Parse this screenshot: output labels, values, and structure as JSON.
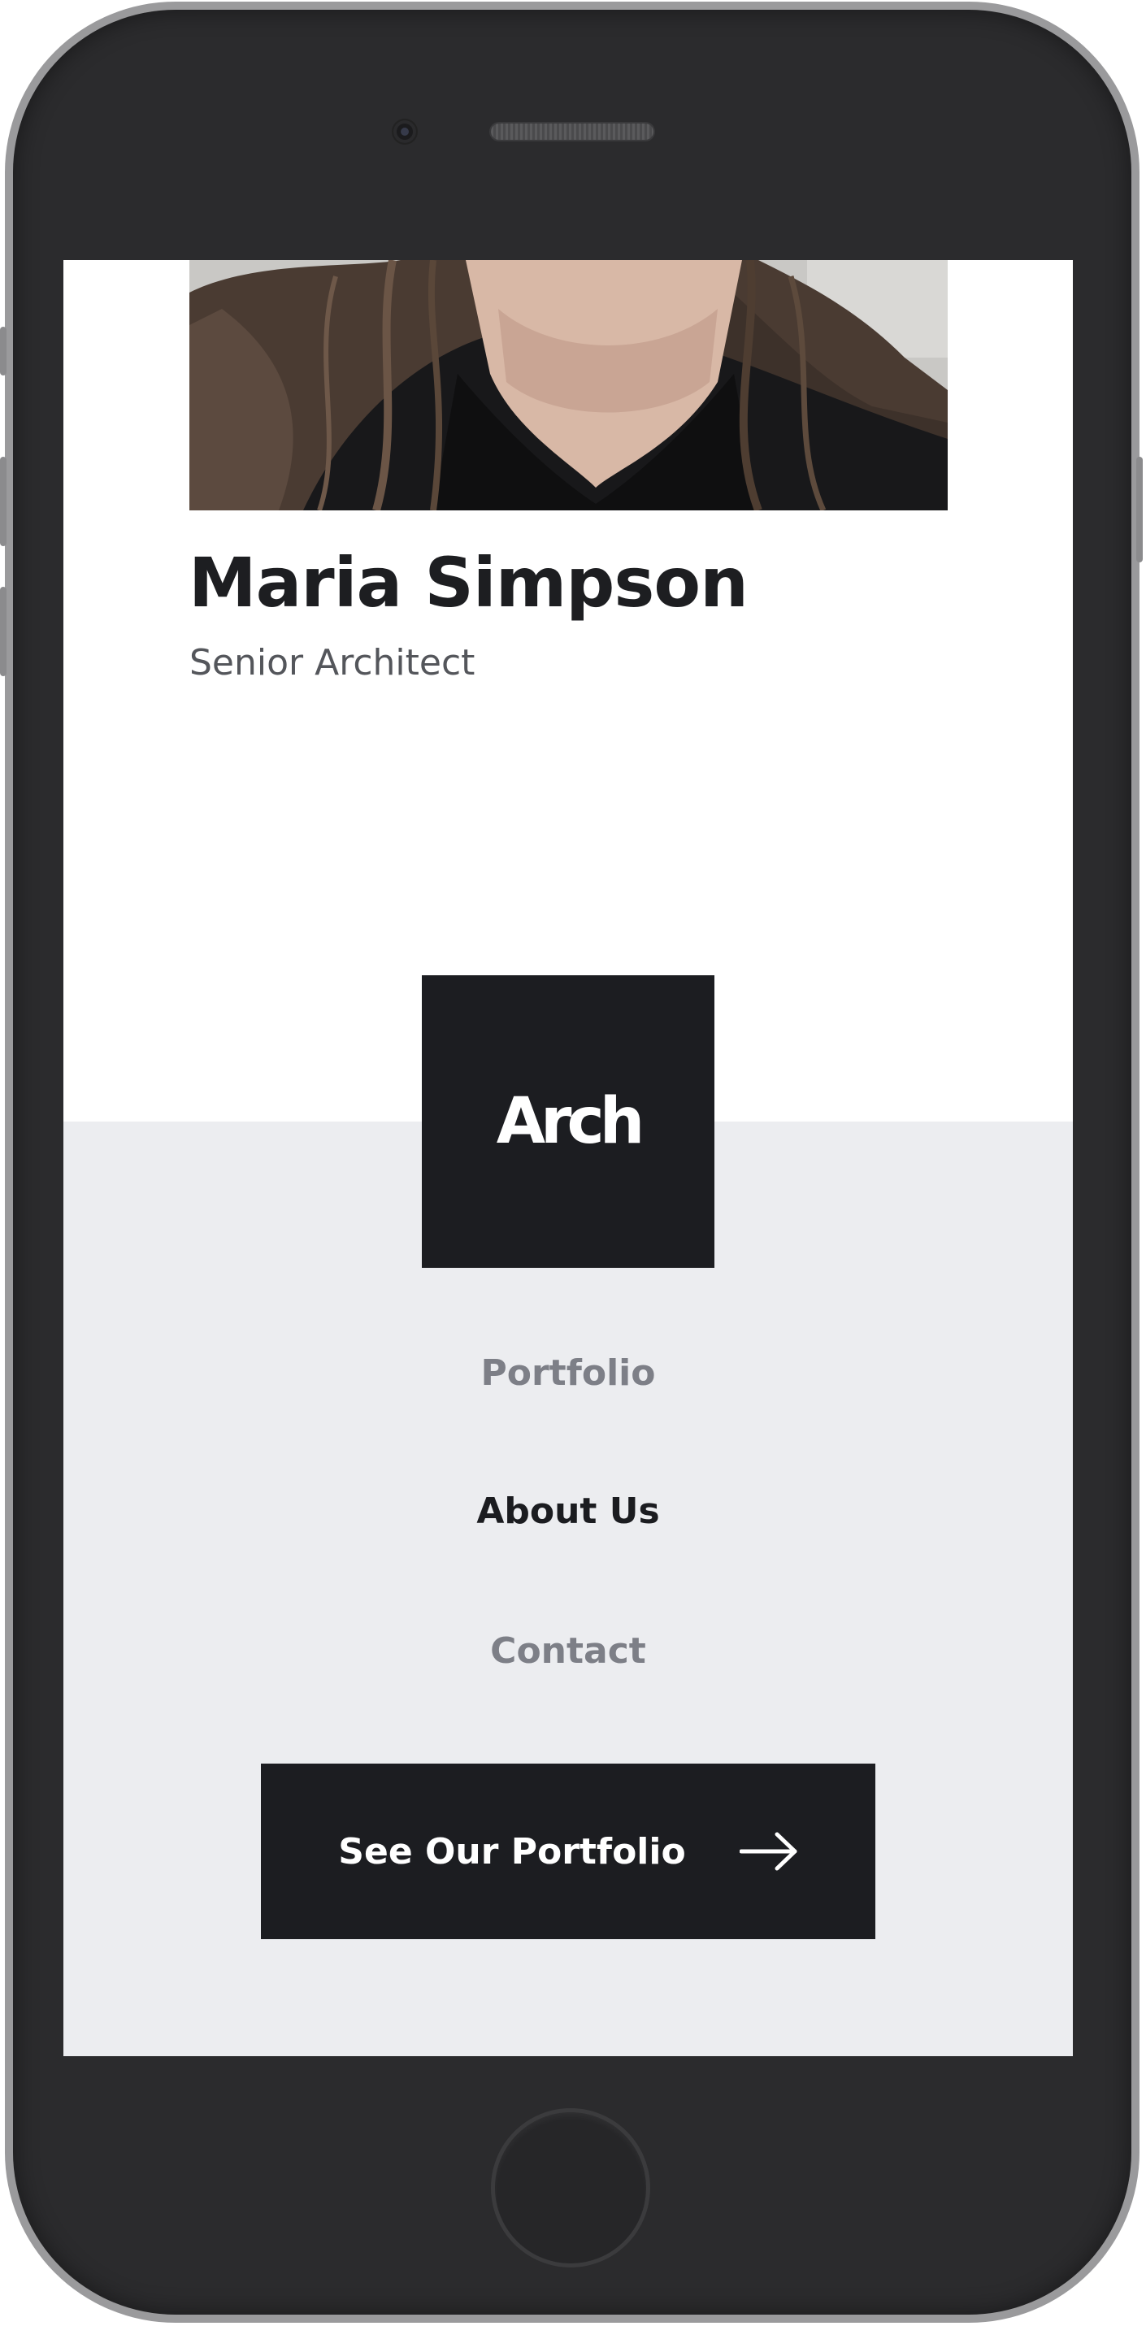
{
  "profile": {
    "name": "Maria Simpson",
    "role": "Senior Architect"
  },
  "brand": {
    "logo_text": "Arch"
  },
  "nav": {
    "items": [
      {
        "label": "Portfolio",
        "active": false
      },
      {
        "label": "About Us",
        "active": true
      },
      {
        "label": "Contact",
        "active": false
      }
    ]
  },
  "cta": {
    "label": "See Our Portfolio",
    "icon": "arrow-right-icon"
  },
  "colors": {
    "dark": "#1c1d21",
    "footer_bg": "#ecedf0",
    "nav_muted": "#7d7f87",
    "nav_active": "#1b1c20",
    "role_text": "#54565b"
  }
}
